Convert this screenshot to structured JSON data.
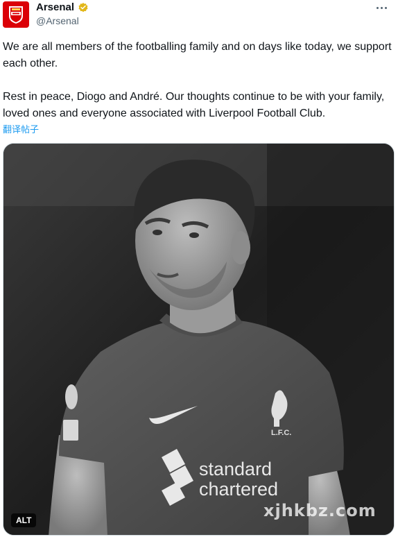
{
  "account": {
    "display_name": "Arsenal",
    "handle": "@Arsenal",
    "avatar_icon": "arsenal-crest-icon",
    "verified_icon": "verified-badge-icon",
    "verified_color": "#e2b719",
    "brand_color": "#db0007"
  },
  "tweet": {
    "paragraph_1": "We are all members of the footballing family and on days like today, we support each other.",
    "paragraph_2": "Rest in peace, Diogo and André. Our thoughts continue to be with your family, loved ones and everyone associated with Liverpool Football Club.",
    "translate_label": "翻译帖子"
  },
  "media": {
    "alt_label": "ALT",
    "shirt_sponsor_line1": "standard",
    "shirt_sponsor_line2": "chartered",
    "crest_text": "L.F.C.",
    "watermark": "xjhkbz.com"
  },
  "accent_color": "#1d9bf0"
}
